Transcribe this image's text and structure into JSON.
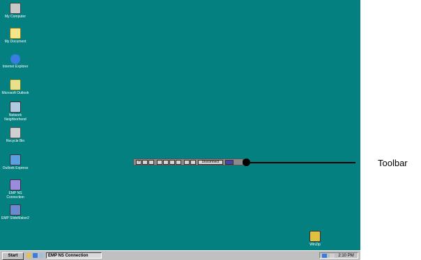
{
  "desktop": {
    "background": "#058080",
    "icons": [
      {
        "label": "My Computer",
        "icon": "computer-icon"
      },
      {
        "label": "My Document",
        "icon": "folder-icon"
      },
      {
        "label": "Internet Explorer",
        "icon": "ie-icon"
      },
      {
        "label": "Microsoft Outlook",
        "icon": "outlook-icon"
      },
      {
        "label": "Network Neighborhood",
        "icon": "network-icon"
      },
      {
        "label": "Recycle Bin",
        "icon": "recycle-bin-icon"
      },
      {
        "label": "Outlook Express",
        "icon": "outlook-express-icon"
      },
      {
        "label": "EMP NS Connection",
        "icon": "emp-ns-icon"
      },
      {
        "label": "EMP SlideMaker2",
        "icon": "emp-slidemaker-icon"
      },
      {
        "label": "WinZip",
        "icon": "winzip-icon"
      }
    ]
  },
  "toolbar": {
    "disconnect_label": "Disconnect"
  },
  "callout": {
    "label": "Toolbar"
  },
  "taskbar": {
    "start_label": "Start",
    "task_label": "EMP NS Connection",
    "clock": "2:10 PM"
  }
}
